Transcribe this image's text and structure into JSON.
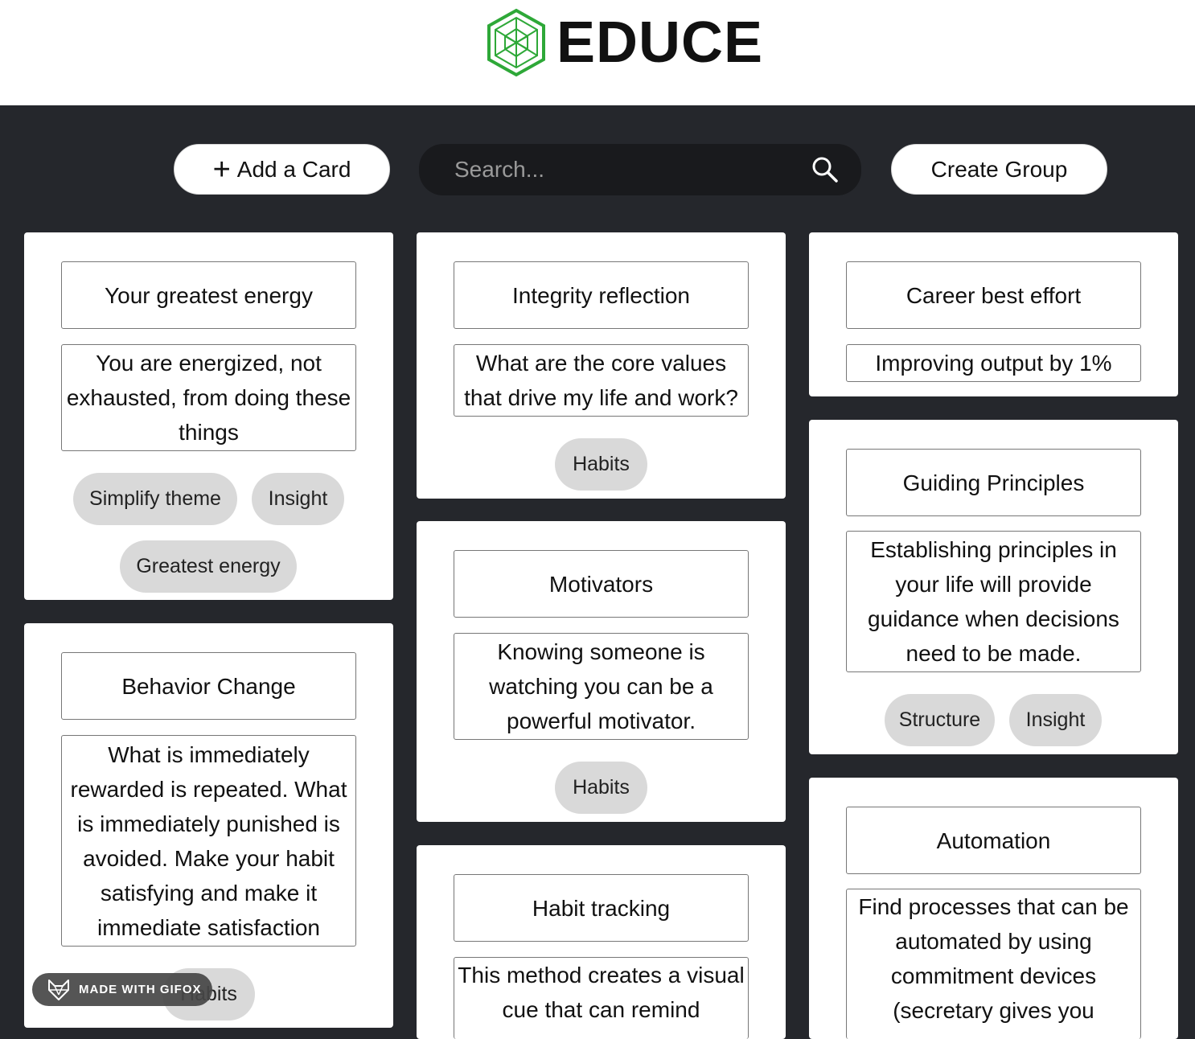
{
  "header": {
    "brand": "EDUCE",
    "logo_icon": "hexagon-network-logo",
    "logo_color": "#2ea838"
  },
  "toolbar": {
    "add_card_label": "Add a Card",
    "search_placeholder": "Search...",
    "create_group_label": "Create Group"
  },
  "cards": [
    {
      "title": "Your greatest energy",
      "body": "You are energized, not exhausted, from doing these things",
      "tags": [
        "Simplify theme",
        "Insight",
        "Greatest energy"
      ]
    },
    {
      "title": "Behavior Change",
      "body": "What is immediately rewarded is repeated. What is immediately punished is avoided. Make your habit satisfying and make it immediate satisfaction",
      "tags": [
        "Habits"
      ]
    },
    {
      "title": "Integrity reflection",
      "body": "What are the core values that drive my life and work?",
      "tags": [
        "Habits"
      ]
    },
    {
      "title": "Motivators",
      "body": "Knowing someone is watching you can be a powerful motivator.",
      "tags": [
        "Habits"
      ]
    },
    {
      "title": "Habit tracking",
      "body": "This method creates a visual cue that can remind",
      "tags": []
    },
    {
      "title": "Career best effort",
      "body": "Improving output by 1%",
      "tags": []
    },
    {
      "title": "Guiding Principles",
      "body": "Establishing principles in your life will provide guidance when decisions need to be made.",
      "tags": [
        "Structure",
        "Insight"
      ]
    },
    {
      "title": "Automation",
      "body": "Find processes that can be automated by using commitment devices (secretary gives you",
      "tags": []
    }
  ],
  "watermark": {
    "label": "MADE WITH GIFOX"
  }
}
